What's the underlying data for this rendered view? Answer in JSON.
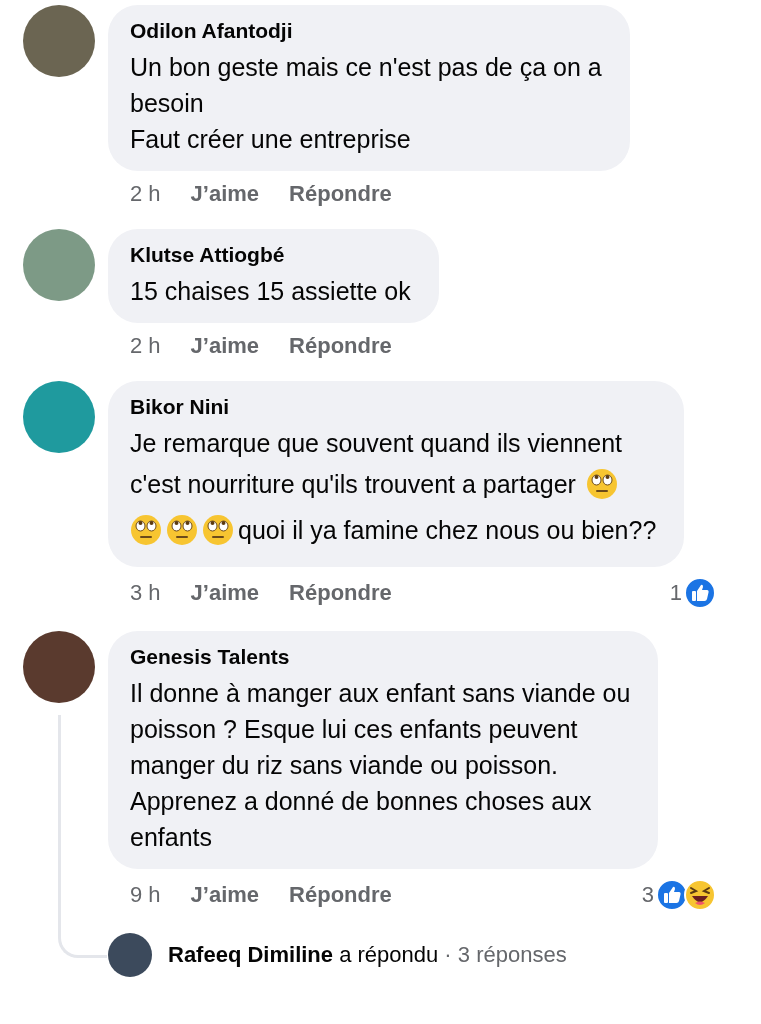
{
  "comments": [
    {
      "author": "Odilon Afantodji",
      "lines": [
        [
          {
            "kind": "text",
            "text": "Un bon geste mais ce n'est pas de ça on a"
          }
        ],
        [
          {
            "kind": "text",
            "text": "besoin"
          }
        ],
        [
          {
            "kind": "text",
            "text": "Faut créer une entreprise"
          }
        ]
      ],
      "time": "2 h",
      "like": "J’aime",
      "reply": "Répondre"
    },
    {
      "author": "Klutse Attiogbé",
      "lines": [
        [
          {
            "kind": "text",
            "text": "15 chaises 15 assiette ok"
          }
        ]
      ],
      "time": "2 h",
      "like": "J’aime",
      "reply": "Répondre"
    },
    {
      "author": "Bikor Nini",
      "lines": [
        [
          {
            "kind": "text",
            "text": "Je remarque que souvent quand ils viennent"
          }
        ],
        [
          {
            "kind": "text",
            "text": "c'est nourriture qu'ils trouvent a partager"
          },
          {
            "kind": "emoji"
          }
        ],
        [
          {
            "kind": "emoji"
          },
          {
            "kind": "emoji"
          },
          {
            "kind": "emoji"
          },
          {
            "kind": "text",
            "text": "quoi il ya famine chez nous ou bien??"
          }
        ]
      ],
      "time": "3 h",
      "like": "J’aime",
      "reply": "Répondre",
      "reaction_count": "1",
      "reactions": [
        {
          "kind": "like"
        }
      ]
    },
    {
      "author": "Genesis Talents",
      "lines": [
        [
          {
            "kind": "text",
            "text": "Il donne à manger aux enfant sans viande ou"
          }
        ],
        [
          {
            "kind": "text",
            "text": "poisson ? Esque lui ces enfants peuvent"
          }
        ],
        [
          {
            "kind": "text",
            "text": "manger du riz sans viande ou poisson."
          }
        ],
        [
          {
            "kind": "text",
            "text": "Apprenez a donné de bonnes choses aux"
          }
        ],
        [
          {
            "kind": "text",
            "text": "enfants"
          }
        ]
      ],
      "time": "9 h",
      "like": "J’aime",
      "reply": "Répondre",
      "reaction_count": "3",
      "reactions": [
        {
          "kind": "like"
        },
        {
          "kind": "haha"
        }
      ],
      "replies_summary": {
        "author": "Rafeeq Dimiline",
        "action": "a répondu",
        "count": "· 3 réponses"
      }
    }
  ]
}
